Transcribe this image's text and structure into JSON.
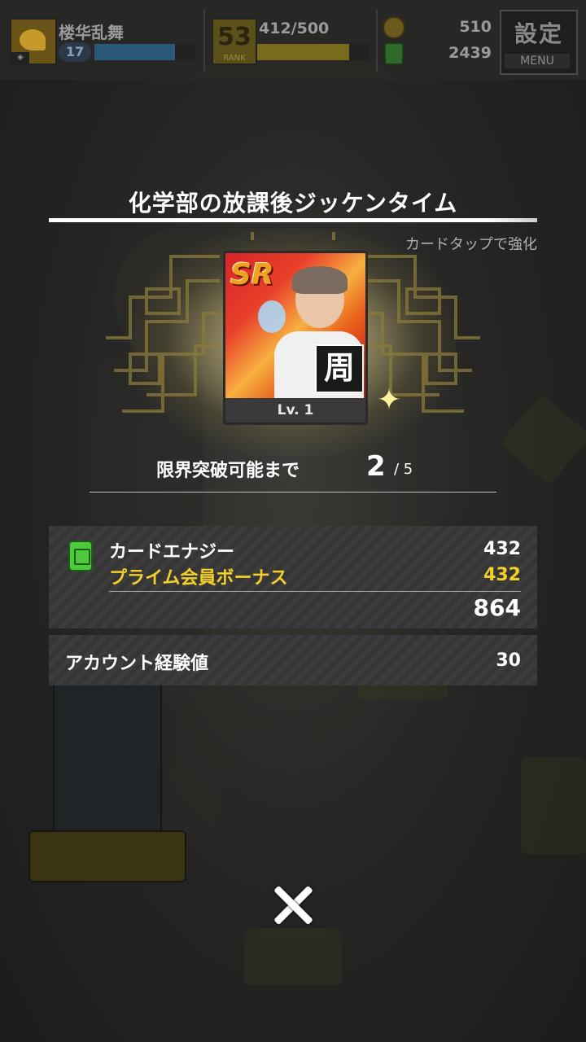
{
  "header": {
    "player_name": "楼华乱舞",
    "player_level": "17",
    "player_level_progress": 0.8,
    "rank": "53",
    "rank_label": "RANK",
    "stamina": "412/500",
    "stamina_progress": 0.82,
    "coins": "510",
    "energy": "2439",
    "menu_kanji": "設定",
    "menu_label": "MENU"
  },
  "dialog": {
    "title": "化学部の放課後ジッケンタイム",
    "hint": "カードタップで強化",
    "card": {
      "rarity": "SR",
      "type_kanji": "周",
      "level_label": "Lv. 1"
    },
    "limit_break": {
      "label": "限界突破可能まで",
      "current": "2",
      "max": "/ 5"
    },
    "rewards": {
      "energy_label": "カードエナジー",
      "energy_value": "432",
      "bonus_label": "プライム会員ボーナス",
      "bonus_value": "432",
      "total_value": "864",
      "exp_label": "アカウント経験値",
      "exp_value": "30"
    }
  },
  "colors": {
    "accent_gold": "#f3cf2a",
    "energy_green": "#4ec83c",
    "card_red": "#d8242a"
  },
  "icons": {
    "energy": "energy-canister-icon",
    "close": "close-icon",
    "coin": "coin-icon",
    "sparkle": "sparkle-icon"
  }
}
